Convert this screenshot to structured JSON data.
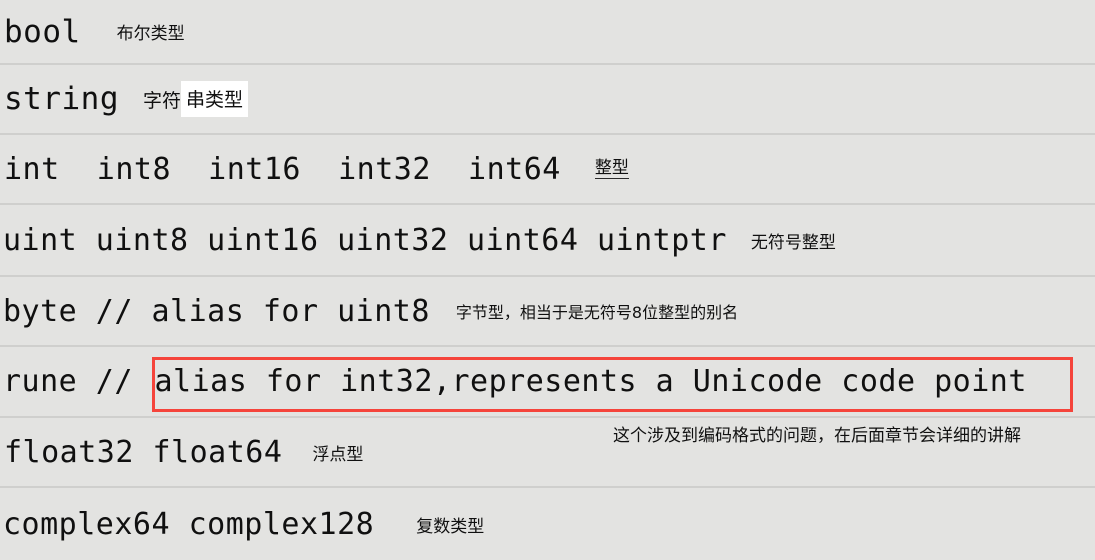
{
  "page": {
    "background_color": "#e3e3e1",
    "divider_color": "#cfcfcd",
    "highlight_box_color": "#f5443b",
    "selection_background": "#ffffff"
  },
  "rows": [
    {
      "id": "bool",
      "code": "bool",
      "note": "布尔类型"
    },
    {
      "id": "string",
      "code": "string",
      "note": "字符",
      "note_highlighted": "串类型"
    },
    {
      "id": "int",
      "code": "int  int8  int16  int32  int64",
      "note": "整型"
    },
    {
      "id": "uint",
      "code": "uint uint8 uint16 uint32 uint64 uintptr",
      "note": "无符号整型"
    },
    {
      "id": "byte",
      "code": "byte // alias for uint8",
      "note": "字节型，相当于是无符号8位整型的别名"
    },
    {
      "id": "rune",
      "code": "rune // ",
      "boxed_code": "alias for int32,represents a Unicode code point",
      "note": ""
    },
    {
      "id": "float",
      "code": "float32 float64",
      "note": "浮点型"
    },
    {
      "id": "complex",
      "code": "complex64 complex128",
      "note": "复数类型"
    }
  ],
  "annotations": {
    "rune_footnote": "这个涉及到编码格式的问题，在后面章节会详细的讲解"
  }
}
